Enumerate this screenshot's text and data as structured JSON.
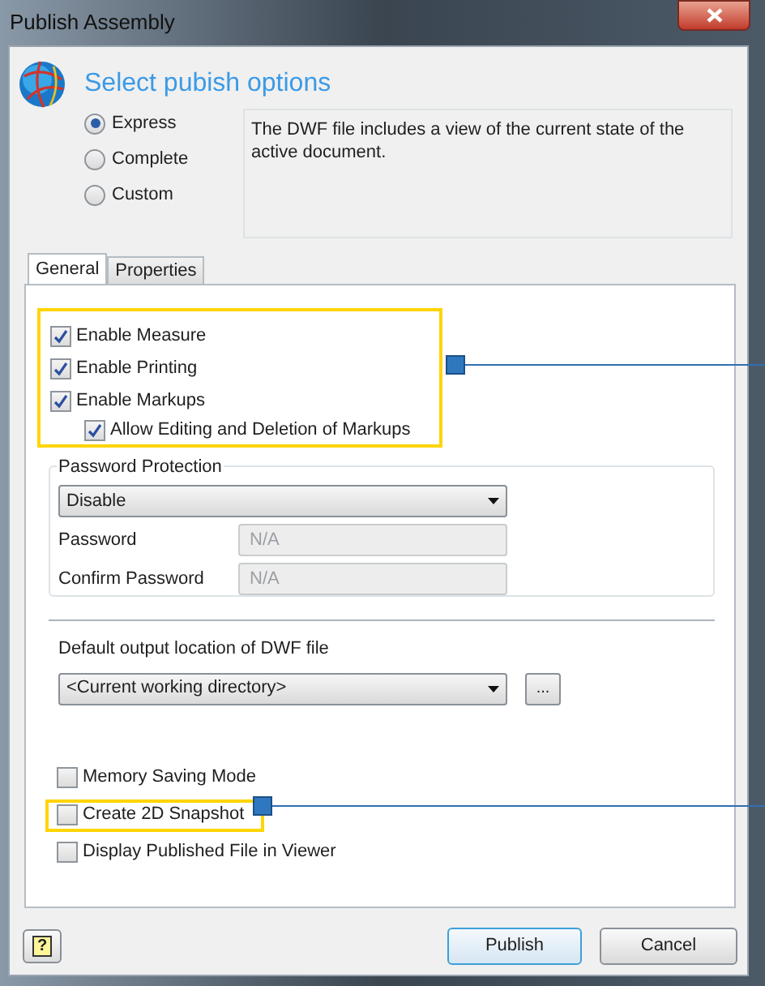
{
  "window": {
    "title": "Publish Assembly"
  },
  "heading": "Select pubish options",
  "modes": [
    {
      "label": "Express",
      "selected": true
    },
    {
      "label": "Complete",
      "selected": false
    },
    {
      "label": "Custom",
      "selected": false
    }
  ],
  "description": "The DWF file includes a view of the current state of the active document.",
  "tabs": [
    {
      "label": "General",
      "selected": true
    },
    {
      "label": "Properties",
      "selected": false
    }
  ],
  "top_options": {
    "highlighted": true,
    "items": [
      {
        "label": "Enable Measure",
        "checked": true
      },
      {
        "label": "Enable Printing",
        "checked": true
      },
      {
        "label": "Enable Markups",
        "checked": true,
        "children": [
          {
            "label": "Allow Editing and Deletion of Markups",
            "checked": true
          }
        ]
      }
    ]
  },
  "password_protection": {
    "legend": "Password Protection",
    "mode": "Disable",
    "fields": [
      {
        "label": "Password",
        "placeholder": "N/A",
        "disabled": true
      },
      {
        "label": "Confirm Password",
        "placeholder": "N/A",
        "disabled": true
      }
    ]
  },
  "output_location": {
    "label": "Default output location of DWF file",
    "value": "<Current working directory>",
    "browse": "..."
  },
  "bottom_options": [
    {
      "label": "Memory Saving Mode",
      "checked": false,
      "highlighted": false
    },
    {
      "label": "Create 2D Snapshot",
      "checked": false,
      "highlighted": true
    },
    {
      "label": "Display Published File in Viewer",
      "checked": false,
      "highlighted": false
    }
  ],
  "buttons": {
    "help": "?",
    "publish": "Publish",
    "cancel": "Cancel"
  }
}
